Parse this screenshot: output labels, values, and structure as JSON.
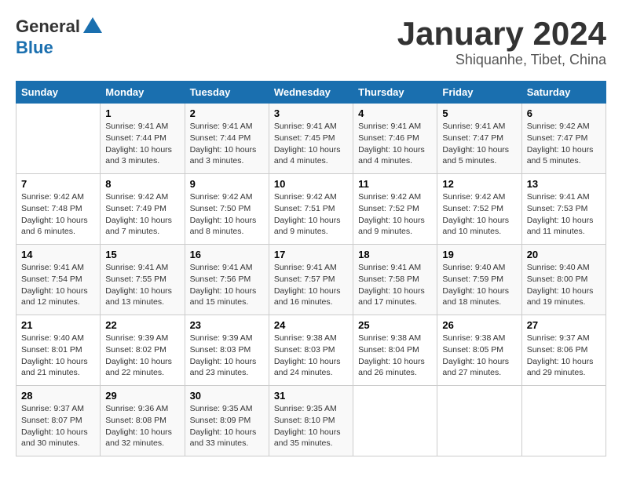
{
  "header": {
    "logo_general": "General",
    "logo_blue": "Blue",
    "month_title": "January 2024",
    "subtitle": "Shiquanhe, Tibet, China"
  },
  "days_of_week": [
    "Sunday",
    "Monday",
    "Tuesday",
    "Wednesday",
    "Thursday",
    "Friday",
    "Saturday"
  ],
  "weeks": [
    [
      {
        "day": "",
        "info": ""
      },
      {
        "day": "1",
        "info": "Sunrise: 9:41 AM\nSunset: 7:44 PM\nDaylight: 10 hours\nand 3 minutes."
      },
      {
        "day": "2",
        "info": "Sunrise: 9:41 AM\nSunset: 7:44 PM\nDaylight: 10 hours\nand 3 minutes."
      },
      {
        "day": "3",
        "info": "Sunrise: 9:41 AM\nSunset: 7:45 PM\nDaylight: 10 hours\nand 4 minutes."
      },
      {
        "day": "4",
        "info": "Sunrise: 9:41 AM\nSunset: 7:46 PM\nDaylight: 10 hours\nand 4 minutes."
      },
      {
        "day": "5",
        "info": "Sunrise: 9:41 AM\nSunset: 7:47 PM\nDaylight: 10 hours\nand 5 minutes."
      },
      {
        "day": "6",
        "info": "Sunrise: 9:42 AM\nSunset: 7:47 PM\nDaylight: 10 hours\nand 5 minutes."
      }
    ],
    [
      {
        "day": "7",
        "info": "Sunrise: 9:42 AM\nSunset: 7:48 PM\nDaylight: 10 hours\nand 6 minutes."
      },
      {
        "day": "8",
        "info": "Sunrise: 9:42 AM\nSunset: 7:49 PM\nDaylight: 10 hours\nand 7 minutes."
      },
      {
        "day": "9",
        "info": "Sunrise: 9:42 AM\nSunset: 7:50 PM\nDaylight: 10 hours\nand 8 minutes."
      },
      {
        "day": "10",
        "info": "Sunrise: 9:42 AM\nSunset: 7:51 PM\nDaylight: 10 hours\nand 9 minutes."
      },
      {
        "day": "11",
        "info": "Sunrise: 9:42 AM\nSunset: 7:52 PM\nDaylight: 10 hours\nand 9 minutes."
      },
      {
        "day": "12",
        "info": "Sunrise: 9:42 AM\nSunset: 7:52 PM\nDaylight: 10 hours\nand 10 minutes."
      },
      {
        "day": "13",
        "info": "Sunrise: 9:41 AM\nSunset: 7:53 PM\nDaylight: 10 hours\nand 11 minutes."
      }
    ],
    [
      {
        "day": "14",
        "info": "Sunrise: 9:41 AM\nSunset: 7:54 PM\nDaylight: 10 hours\nand 12 minutes."
      },
      {
        "day": "15",
        "info": "Sunrise: 9:41 AM\nSunset: 7:55 PM\nDaylight: 10 hours\nand 13 minutes."
      },
      {
        "day": "16",
        "info": "Sunrise: 9:41 AM\nSunset: 7:56 PM\nDaylight: 10 hours\nand 15 minutes."
      },
      {
        "day": "17",
        "info": "Sunrise: 9:41 AM\nSunset: 7:57 PM\nDaylight: 10 hours\nand 16 minutes."
      },
      {
        "day": "18",
        "info": "Sunrise: 9:41 AM\nSunset: 7:58 PM\nDaylight: 10 hours\nand 17 minutes."
      },
      {
        "day": "19",
        "info": "Sunrise: 9:40 AM\nSunset: 7:59 PM\nDaylight: 10 hours\nand 18 minutes."
      },
      {
        "day": "20",
        "info": "Sunrise: 9:40 AM\nSunset: 8:00 PM\nDaylight: 10 hours\nand 19 minutes."
      }
    ],
    [
      {
        "day": "21",
        "info": "Sunrise: 9:40 AM\nSunset: 8:01 PM\nDaylight: 10 hours\nand 21 minutes."
      },
      {
        "day": "22",
        "info": "Sunrise: 9:39 AM\nSunset: 8:02 PM\nDaylight: 10 hours\nand 22 minutes."
      },
      {
        "day": "23",
        "info": "Sunrise: 9:39 AM\nSunset: 8:03 PM\nDaylight: 10 hours\nand 23 minutes."
      },
      {
        "day": "24",
        "info": "Sunrise: 9:38 AM\nSunset: 8:03 PM\nDaylight: 10 hours\nand 24 minutes."
      },
      {
        "day": "25",
        "info": "Sunrise: 9:38 AM\nSunset: 8:04 PM\nDaylight: 10 hours\nand 26 minutes."
      },
      {
        "day": "26",
        "info": "Sunrise: 9:38 AM\nSunset: 8:05 PM\nDaylight: 10 hours\nand 27 minutes."
      },
      {
        "day": "27",
        "info": "Sunrise: 9:37 AM\nSunset: 8:06 PM\nDaylight: 10 hours\nand 29 minutes."
      }
    ],
    [
      {
        "day": "28",
        "info": "Sunrise: 9:37 AM\nSunset: 8:07 PM\nDaylight: 10 hours\nand 30 minutes."
      },
      {
        "day": "29",
        "info": "Sunrise: 9:36 AM\nSunset: 8:08 PM\nDaylight: 10 hours\nand 32 minutes."
      },
      {
        "day": "30",
        "info": "Sunrise: 9:35 AM\nSunset: 8:09 PM\nDaylight: 10 hours\nand 33 minutes."
      },
      {
        "day": "31",
        "info": "Sunrise: 9:35 AM\nSunset: 8:10 PM\nDaylight: 10 hours\nand 35 minutes."
      },
      {
        "day": "",
        "info": ""
      },
      {
        "day": "",
        "info": ""
      },
      {
        "day": "",
        "info": ""
      }
    ]
  ]
}
